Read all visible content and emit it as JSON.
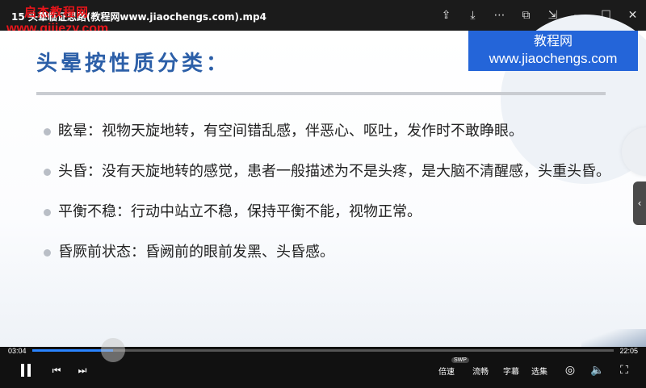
{
  "titlebar": {
    "title": "15 头晕临证思路(教程网www.jiaochengs.com).mp4",
    "watermark_cn": "启杰教程网",
    "watermark_url": "www.qijiezy.com",
    "icons": [
      "share-icon",
      "download-icon",
      "more-icon",
      "pip-icon",
      "minimize-to-corner-icon",
      "minimize-icon",
      "maximize-icon",
      "close-icon"
    ]
  },
  "slide": {
    "title": "头晕按性质分类：",
    "logo_cn": "教程网",
    "logo_url": "www.jiaochengs.com",
    "bullets": [
      "眩晕：视物天旋地转，有空间错乱感，伴恶心、呕吐，发作时不敢睁眼。",
      "头昏：没有天旋地转的感觉，患者一般描述为不是头疼，是大脑不清醒感，头重头昏。",
      "平衡不稳：行动中站立不稳，保持平衡不能，视物正常。",
      "昏厥前状态：昏阙前的眼前发黑、头昏感。"
    ]
  },
  "controls": {
    "current_time": "03:04",
    "total_time": "22:05",
    "progress": 0.139,
    "speed_label": "倍速",
    "swp_badge": "SWP",
    "quality_label": "流畅",
    "subtitle_label": "字幕",
    "select_label": "选集"
  },
  "colors": {
    "title_blue": "#2c5fa8",
    "logo_bg": "#2465d9",
    "watermark_red": "#e8151b",
    "progress_blue": "#2a84ff"
  }
}
